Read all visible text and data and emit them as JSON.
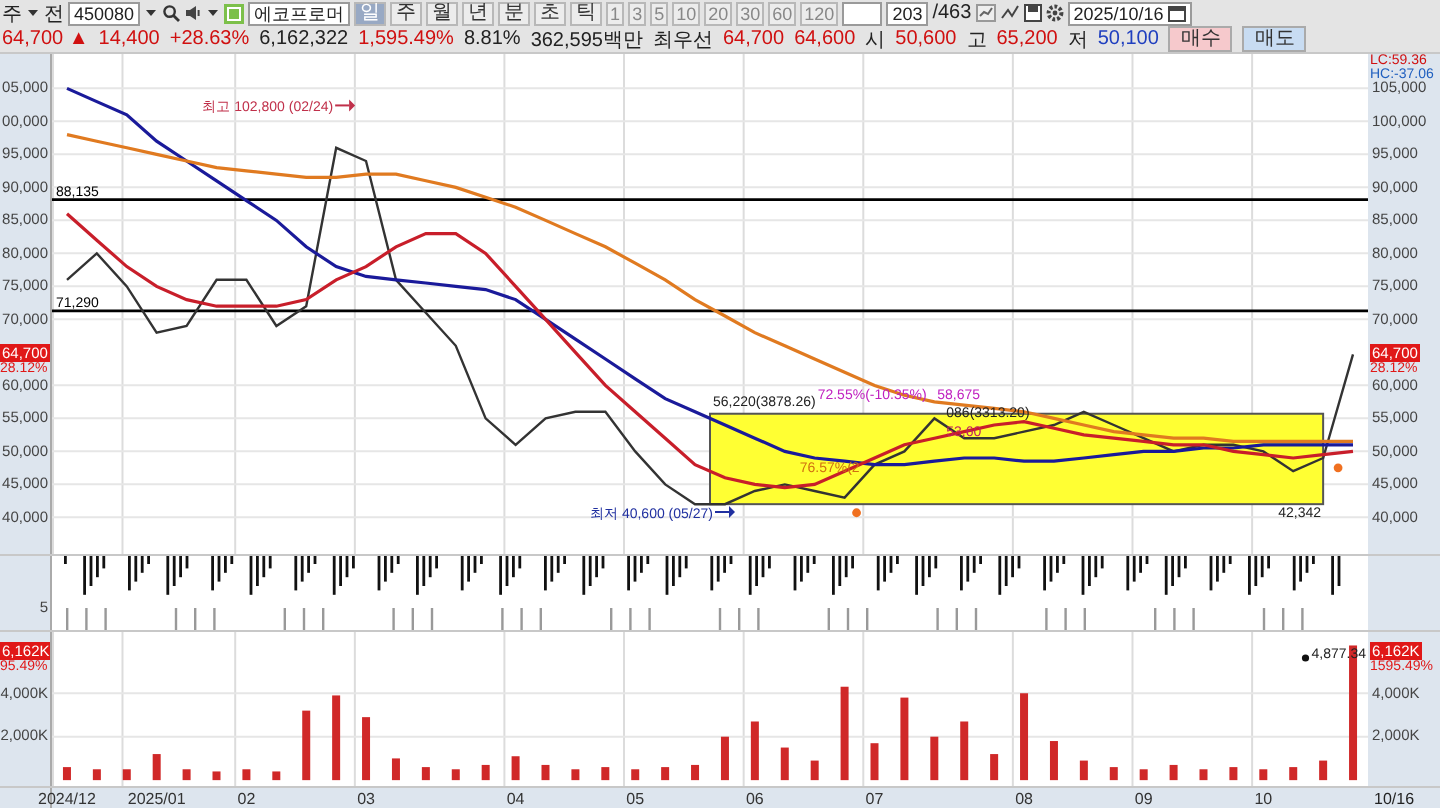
{
  "toolbar": {
    "items": [
      {
        "kind": "text",
        "text": "주"
      },
      {
        "kind": "caret"
      },
      {
        "kind": "text",
        "text": "전"
      },
      {
        "kind": "field",
        "text": "450080"
      },
      {
        "kind": "caret"
      },
      {
        "kind": "search"
      },
      {
        "kind": "speaker"
      },
      {
        "kind": "caret"
      },
      {
        "kind": "logo"
      },
      {
        "kind": "name",
        "text": "에코프로머"
      },
      {
        "kind": "period",
        "text": "일",
        "selected": true
      },
      {
        "kind": "period",
        "text": "주",
        "selected": false
      },
      {
        "kind": "period",
        "text": "월",
        "selected": false
      },
      {
        "kind": "period",
        "text": "년",
        "selected": false
      },
      {
        "kind": "period",
        "text": "분",
        "selected": false
      },
      {
        "kind": "period",
        "text": "초",
        "selected": false
      },
      {
        "kind": "period",
        "text": "틱",
        "selected": false
      },
      {
        "kind": "interval",
        "text": "1",
        "selected": false
      },
      {
        "kind": "interval",
        "text": "3",
        "selected": false
      },
      {
        "kind": "interval",
        "text": "5",
        "selected": false
      },
      {
        "kind": "interval",
        "text": "10",
        "selected": false
      },
      {
        "kind": "interval",
        "text": "20",
        "selected": false
      },
      {
        "kind": "interval",
        "text": "30",
        "selected": false
      },
      {
        "kind": "interval",
        "text": "60",
        "selected": false
      },
      {
        "kind": "interval",
        "text": "120",
        "selected": false
      },
      {
        "kind": "blank_field"
      },
      {
        "kind": "field",
        "text": "203"
      },
      {
        "kind": "text",
        "text": "/463"
      },
      {
        "kind": "chart_tool"
      },
      {
        "kind": "line_tool"
      },
      {
        "kind": "save"
      },
      {
        "kind": "gear"
      },
      {
        "kind": "date",
        "text": "2025/10/16"
      }
    ]
  },
  "quote_bar": {
    "items": [
      {
        "kind": "value",
        "text": "64,700 ▲",
        "color": "#d01010"
      },
      {
        "kind": "value",
        "text": "14,400",
        "color": "#d01010"
      },
      {
        "kind": "value",
        "text": "+28.63%",
        "color": "#d01010"
      },
      {
        "kind": "value",
        "text": "6,162,322",
        "color": "#222222"
      },
      {
        "kind": "value",
        "text": "1,595.49%",
        "color": "#d01010"
      },
      {
        "kind": "value",
        "text": "8.81%",
        "color": "#222222"
      },
      {
        "kind": "value",
        "text": "362,595백만",
        "color": "#222222"
      },
      {
        "kind": "value",
        "text": "최우선",
        "color": "#222222"
      },
      {
        "kind": "value",
        "text": "64,700",
        "color": "#d01010"
      },
      {
        "kind": "value",
        "text": "64,600",
        "color": "#d01010"
      },
      {
        "kind": "value",
        "text": "시",
        "color": "#222222"
      },
      {
        "kind": "value",
        "text": "50,600",
        "color": "#d01010"
      },
      {
        "kind": "value",
        "text": "고",
        "color": "#222222"
      },
      {
        "kind": "value",
        "text": "65,200",
        "color": "#d01010"
      },
      {
        "kind": "value",
        "text": "저",
        "color": "#222222"
      },
      {
        "kind": "value",
        "text": "50,100",
        "color": "#1f3fbf"
      },
      {
        "kind": "buy",
        "text": "매수"
      },
      {
        "kind": "sell",
        "text": "매도"
      }
    ]
  },
  "price_panel": {
    "left_tick_labels": [
      "05,000",
      "00,000",
      "95,000",
      "90,000",
      "85,000",
      "80,000",
      "75,000",
      "70,000",
      "60,000",
      "55,000",
      "50,000",
      "45,000",
      "40,000"
    ],
    "left_badge": {
      "value": "64,700",
      "change": "28.12%"
    },
    "right_badge": {
      "value": "64,700",
      "change": "28.12%"
    },
    "top_labels": [
      {
        "text": "LC:59.36",
        "color": "#d01010"
      },
      {
        "text": "HC:-37.06",
        "color": "#1f5fbf"
      }
    ],
    "chart_data": {
      "type": "line",
      "grid": true,
      "ylim": [
        34450,
        110200
      ],
      "categories": [
        null,
        null,
        null,
        null,
        null,
        null,
        null,
        null,
        null,
        null,
        null,
        null,
        null,
        null,
        null,
        null,
        null,
        null,
        null,
        null,
        null,
        null,
        null,
        null,
        null,
        null,
        null,
        null,
        null,
        null,
        null,
        null,
        null,
        null,
        null,
        null,
        null,
        null,
        null,
        null,
        null,
        null,
        null,
        null
      ],
      "yticks": [
        {
          "value": 40000,
          "label": "40,000"
        },
        {
          "value": 45000,
          "label": "45,000"
        },
        {
          "value": 50000,
          "label": "50,000"
        },
        {
          "value": 55000,
          "label": "55,000"
        },
        {
          "value": 60000,
          "label": "60,000"
        },
        {
          "value": 70000,
          "label": "70,000"
        },
        {
          "value": 75000,
          "label": "75,000"
        },
        {
          "value": 80000,
          "label": "80,000"
        },
        {
          "value": 85000,
          "label": "85,000"
        },
        {
          "value": 90000,
          "label": "90,000"
        },
        {
          "value": 95000,
          "label": "95,000"
        },
        {
          "value": 100000,
          "label": "100,000"
        },
        {
          "value": 105000,
          "label": "105,000"
        }
      ],
      "series": [
        {
          "color": "#333333",
          "values": [
            76000,
            80000,
            75000,
            68000,
            69000,
            76000,
            76000,
            69000,
            72000,
            96000,
            94000,
            76000,
            71000,
            66000,
            55000,
            51000,
            55000,
            56000,
            56000,
            50000,
            45000,
            42000,
            42000,
            44000,
            45000,
            44000,
            43000,
            48000,
            50000,
            55000,
            52000,
            52000,
            53000,
            54000,
            56000,
            54000,
            52000,
            50000,
            51000,
            51000,
            50000,
            47000,
            49000,
            64700
          ]
        },
        {
          "color": "#1a1a9a",
          "values": [
            105000,
            103000,
            101000,
            97000,
            94000,
            91000,
            88000,
            85000,
            81000,
            78000,
            76500,
            76000,
            75500,
            75000,
            74500,
            73000,
            70000,
            67000,
            64000,
            61000,
            58000,
            56000,
            54000,
            52000,
            50000,
            49000,
            48500,
            48000,
            48000,
            48500,
            49000,
            49000,
            48500,
            48500,
            49000,
            49500,
            50000,
            50000,
            50500,
            50500,
            51000,
            51000,
            51000,
            51000
          ]
        },
        {
          "color": "#e07a20",
          "values": [
            98000,
            97000,
            96000,
            95000,
            94000,
            93000,
            92500,
            92000,
            91500,
            91500,
            92000,
            92000,
            91000,
            90000,
            88500,
            87000,
            85000,
            83000,
            81000,
            78500,
            76000,
            73000,
            70500,
            68000,
            66000,
            64000,
            62000,
            60000,
            58500,
            57500,
            57000,
            56500,
            56000,
            55000,
            54000,
            53000,
            52500,
            52000,
            52000,
            51500,
            51500,
            51500,
            51500,
            51500
          ]
        },
        {
          "color": "#c81e2a",
          "values": [
            86000,
            82000,
            78000,
            75000,
            73000,
            72000,
            72000,
            72000,
            73000,
            76000,
            78000,
            81000,
            83000,
            83000,
            80000,
            75000,
            70000,
            65000,
            60000,
            56000,
            52000,
            48000,
            46000,
            45000,
            44500,
            45000,
            47000,
            49000,
            51000,
            52000,
            53000,
            54000,
            54500,
            53500,
            52500,
            52000,
            51500,
            51000,
            51000,
            50000,
            49500,
            49000,
            49500,
            50000
          ]
        }
      ],
      "ref_lines": [
        {
          "axis": "y",
          "value": 88135,
          "label": "88,135"
        },
        {
          "axis": "y",
          "value": 71290,
          "label": "71,290"
        }
      ],
      "annotations": [
        "최고 102,800 (02/24)",
        "최저 40,600 (05/27)",
        "56,220(3878.26)",
        "72.55%(-10.35%)",
        "58,675",
        "086(3313.20)",
        "53,60",
        "76.57%(2",
        "42,342"
      ]
    }
  },
  "indicator_panel": {
    "tick_label": "5"
  },
  "volume_panel": {
    "left_tick_labels": [
      "4,000K",
      "2,000K"
    ],
    "left_badge": {
      "value": "6,162K",
      "change": "95.49%"
    },
    "right_badge": {
      "value": "6,162K",
      "change": "1595.49%"
    },
    "chart_data": {
      "type": "bar",
      "grid": true,
      "ylim": [
        -270,
        6820
      ],
      "categories": [
        "2024/12",
        null,
        null,
        "2025/01",
        null,
        null,
        "02",
        null,
        null,
        null,
        "03",
        null,
        null,
        null,
        null,
        "04",
        null,
        null,
        null,
        "05",
        null,
        null,
        null,
        "06",
        null,
        null,
        null,
        "07",
        null,
        null,
        null,
        null,
        "08",
        null,
        null,
        null,
        "09",
        null,
        null,
        null,
        "10",
        null,
        null,
        null
      ],
      "yticks": [
        {
          "value": 2000,
          "label": "2,000K"
        },
        {
          "value": 4000,
          "label": "4,000K"
        }
      ],
      "series": [
        {
          "color": "#d02828",
          "values": [
            600,
            500,
            500,
            1200,
            500,
            400,
            500,
            400,
            3200,
            3900,
            2900,
            1000,
            600,
            500,
            700,
            1100,
            700,
            500,
            600,
            500,
            600,
            700,
            2000,
            2700,
            1500,
            900,
            4300,
            1700,
            3800,
            2000,
            2700,
            1200,
            4000,
            1800,
            900,
            600,
            500,
            700,
            500,
            600,
            500,
            600,
            900,
            6200
          ]
        }
      ],
      "annotations": [
        "4,877.34"
      ]
    }
  },
  "date_axis": {
    "end_label": "10/16"
  }
}
